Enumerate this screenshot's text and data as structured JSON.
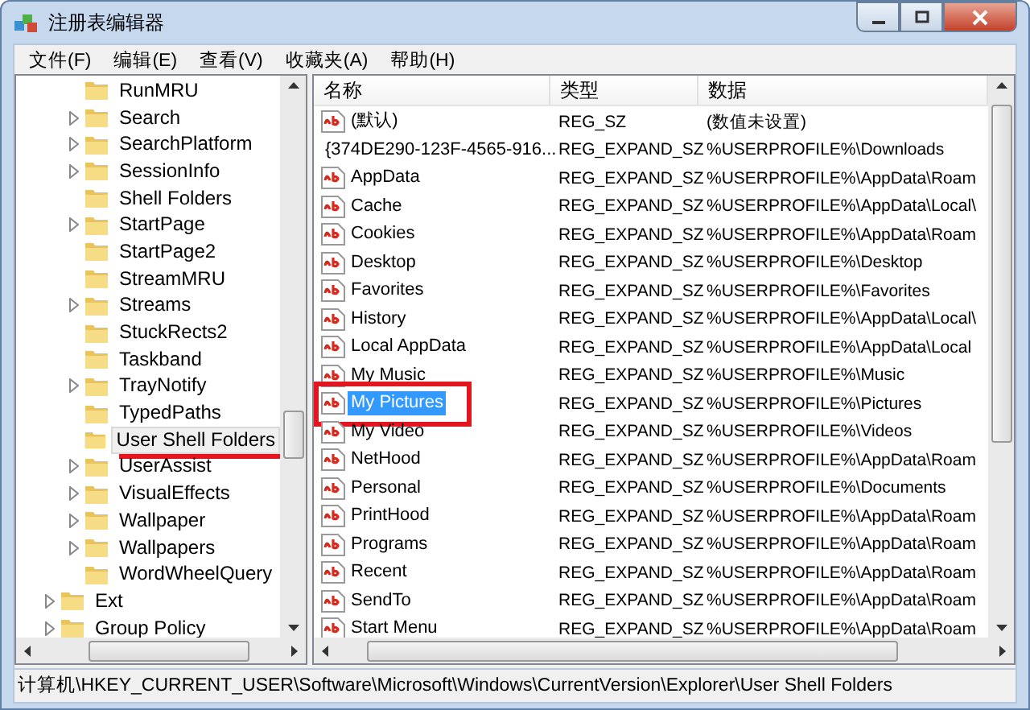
{
  "window": {
    "title": "注册表编辑器"
  },
  "menu": [
    "文件(F)",
    "编辑(E)",
    "查看(V)",
    "收藏夹(A)",
    "帮助(H)"
  ],
  "tree": {
    "items": [
      {
        "children": [
          {
            "label": "RunMRU",
            "expandable": false,
            "selected": false,
            "underlined": false
          },
          {
            "label": "Search",
            "expandable": true,
            "selected": false,
            "underlined": false
          },
          {
            "label": "SearchPlatform",
            "expandable": true,
            "selected": false,
            "underlined": false
          },
          {
            "label": "SessionInfo",
            "expandable": true,
            "selected": false,
            "underlined": false
          },
          {
            "label": "Shell Folders",
            "expandable": false,
            "selected": false,
            "underlined": false
          },
          {
            "label": "StartPage",
            "expandable": true,
            "selected": false,
            "underlined": false
          },
          {
            "label": "StartPage2",
            "expandable": false,
            "selected": false,
            "underlined": false
          },
          {
            "label": "StreamMRU",
            "expandable": false,
            "selected": false,
            "underlined": false
          },
          {
            "label": "Streams",
            "expandable": true,
            "selected": false,
            "underlined": false
          },
          {
            "label": "StuckRects2",
            "expandable": false,
            "selected": false,
            "underlined": false
          },
          {
            "label": "Taskband",
            "expandable": false,
            "selected": false,
            "underlined": false
          },
          {
            "label": "TrayNotify",
            "expandable": true,
            "selected": false,
            "underlined": false
          },
          {
            "label": "TypedPaths",
            "expandable": false,
            "selected": false,
            "underlined": false
          },
          {
            "label": "User Shell Folders",
            "expandable": false,
            "selected": true,
            "underlined": true
          },
          {
            "label": "UserAssist",
            "expandable": true,
            "selected": false,
            "underlined": false
          },
          {
            "label": "VisualEffects",
            "expandable": true,
            "selected": false,
            "underlined": false
          },
          {
            "label": "Wallpaper",
            "expandable": true,
            "selected": false,
            "underlined": false
          },
          {
            "label": "Wallpapers",
            "expandable": true,
            "selected": false,
            "underlined": false
          },
          {
            "label": "WordWheelQuery",
            "expandable": false,
            "selected": false,
            "underlined": false
          }
        ]
      },
      {
        "label": "Ext",
        "expandable": true,
        "selected": false,
        "underlined": false
      },
      {
        "label": "Group Policy",
        "expandable": true,
        "selected": false,
        "underlined": false
      }
    ]
  },
  "table": {
    "columns": [
      "名称",
      "类型",
      "数据"
    ],
    "rows": [
      {
        "name": "(默认)",
        "type": "REG_SZ",
        "data": "(数值未设置)",
        "selected": false,
        "highlighted": false
      },
      {
        "name": "{374DE290-123F-4565-916...",
        "type": "REG_EXPAND_SZ",
        "data": "%USERPROFILE%\\Downloads",
        "selected": false,
        "highlighted": false
      },
      {
        "name": "AppData",
        "type": "REG_EXPAND_SZ",
        "data": "%USERPROFILE%\\AppData\\Roam",
        "selected": false,
        "highlighted": false
      },
      {
        "name": "Cache",
        "type": "REG_EXPAND_SZ",
        "data": "%USERPROFILE%\\AppData\\Local\\",
        "selected": false,
        "highlighted": false
      },
      {
        "name": "Cookies",
        "type": "REG_EXPAND_SZ",
        "data": "%USERPROFILE%\\AppData\\Roam",
        "selected": false,
        "highlighted": false
      },
      {
        "name": "Desktop",
        "type": "REG_EXPAND_SZ",
        "data": "%USERPROFILE%\\Desktop",
        "selected": false,
        "highlighted": false
      },
      {
        "name": "Favorites",
        "type": "REG_EXPAND_SZ",
        "data": "%USERPROFILE%\\Favorites",
        "selected": false,
        "highlighted": false
      },
      {
        "name": "History",
        "type": "REG_EXPAND_SZ",
        "data": "%USERPROFILE%\\AppData\\Local\\",
        "selected": false,
        "highlighted": false
      },
      {
        "name": "Local AppData",
        "type": "REG_EXPAND_SZ",
        "data": "%USERPROFILE%\\AppData\\Local",
        "selected": false,
        "highlighted": false
      },
      {
        "name": "My Music",
        "type": "REG_EXPAND_SZ",
        "data": "%USERPROFILE%\\Music",
        "selected": false,
        "highlighted": false
      },
      {
        "name": "My Pictures",
        "type": "REG_EXPAND_SZ",
        "data": "%USERPROFILE%\\Pictures",
        "selected": true,
        "highlighted": true
      },
      {
        "name": "My Video",
        "type": "REG_EXPAND_SZ",
        "data": "%USERPROFILE%\\Videos",
        "selected": false,
        "highlighted": false
      },
      {
        "name": "NetHood",
        "type": "REG_EXPAND_SZ",
        "data": "%USERPROFILE%\\AppData\\Roam",
        "selected": false,
        "highlighted": false
      },
      {
        "name": "Personal",
        "type": "REG_EXPAND_SZ",
        "data": "%USERPROFILE%\\Documents",
        "selected": false,
        "highlighted": false
      },
      {
        "name": "PrintHood",
        "type": "REG_EXPAND_SZ",
        "data": "%USERPROFILE%\\AppData\\Roam",
        "selected": false,
        "highlighted": false
      },
      {
        "name": "Programs",
        "type": "REG_EXPAND_SZ",
        "data": "%USERPROFILE%\\AppData\\Roam",
        "selected": false,
        "highlighted": false
      },
      {
        "name": "Recent",
        "type": "REG_EXPAND_SZ",
        "data": "%USERPROFILE%\\AppData\\Roam",
        "selected": false,
        "highlighted": false
      },
      {
        "name": "SendTo",
        "type": "REG_EXPAND_SZ",
        "data": "%USERPROFILE%\\AppData\\Roam",
        "selected": false,
        "highlighted": false
      },
      {
        "name": "Start Menu",
        "type": "REG_EXPAND_SZ",
        "data": "%USERPROFILE%\\AppData\\Roam",
        "selected": false,
        "highlighted": false
      }
    ]
  },
  "status_bar": "计算机\\HKEY_CURRENT_USER\\Software\\Microsoft\\Windows\\CurrentVersion\\Explorer\\User Shell Folders"
}
